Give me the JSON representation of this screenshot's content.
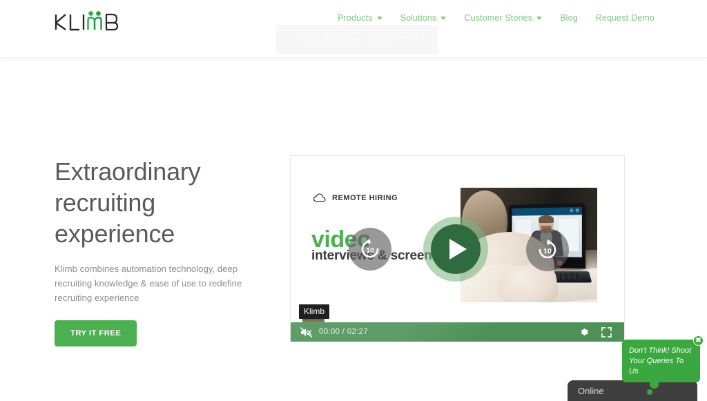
{
  "brand": {
    "logo_text": "KLIMB",
    "logo_accent_color": "#22b14c",
    "logo_text_color": "#2b2b2b"
  },
  "header": {
    "nav": [
      {
        "label": "Products",
        "has_dropdown": true,
        "icon": "chevron-down-icon"
      },
      {
        "label": "Solutions",
        "has_dropdown": true,
        "icon": "chevron-down-icon"
      },
      {
        "label": "Customer Stories",
        "has_dropdown": true,
        "icon": "chevron-down-icon"
      },
      {
        "label": "Blog",
        "has_dropdown": false
      },
      {
        "label": "Request Demo",
        "has_dropdown": false
      }
    ],
    "nav_color": "#82c785"
  },
  "fullscreen_toast": {
    "message": "To exit full screen, press",
    "key": "F11"
  },
  "hero": {
    "title_line_1": "Extraordinary",
    "title_line_2": "recruiting",
    "title_line_3": "experience",
    "subtitle": "Klimb combines automation technology, deep recruiting knowledge & ease of use to redefine recruiting experience",
    "cta_label": "TRY IT FREE",
    "cta_color": "#4caf50"
  },
  "video": {
    "badge_label": "REMOTE HIRING",
    "badge_icon": "cloud-icon",
    "headline_accent": "video",
    "headline_rest": "interviews & screening",
    "accent_color": "#4caf50",
    "play_icon": "play-icon",
    "rewind_label": "10",
    "rewind_icon": "rewind-10-icon",
    "forward_label": "10",
    "forward_icon": "forward-10-icon",
    "tooltip_label": "Klimb",
    "controls": {
      "mute_icon": "volume-muted-icon",
      "current_time": "00:00",
      "separator": "/",
      "duration": "02:27",
      "settings_icon": "gear-icon",
      "fullscreen_icon": "fullscreen-icon",
      "bar_color": "#4d9157"
    }
  },
  "chat": {
    "bubble_text_line_1": "Don't Think! Shoot",
    "bubble_text_line_2": "Your Queries To Us",
    "close_icon": "close-icon",
    "close_label": "✖",
    "status_label": "Online",
    "bubble_color": "#3aa83f",
    "widget_color": "#3f3f3f"
  }
}
